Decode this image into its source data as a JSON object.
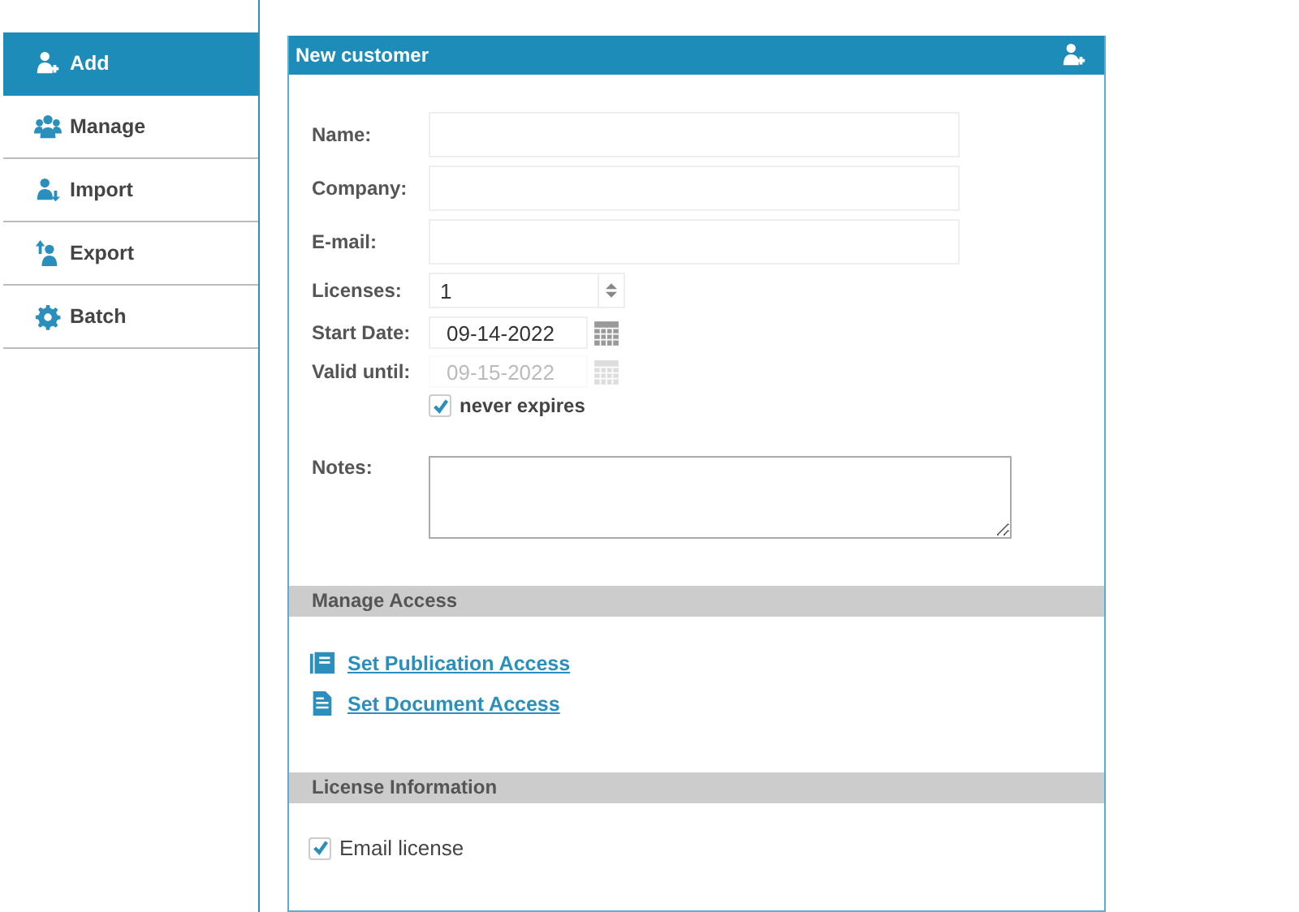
{
  "sidebar": {
    "items": [
      {
        "label": "Add",
        "selected": true
      },
      {
        "label": "Manage",
        "selected": false
      },
      {
        "label": "Import",
        "selected": false
      },
      {
        "label": "Export",
        "selected": false
      },
      {
        "label": "Batch",
        "selected": false
      }
    ]
  },
  "panel": {
    "title": "New customer",
    "fields": [
      {
        "kind": "text",
        "label": "Name:"
      },
      {
        "kind": "text",
        "label": "Company:"
      },
      {
        "kind": "text",
        "label": "E-mail:"
      },
      {
        "kind": "number",
        "label": "Licenses:",
        "value": "1"
      },
      {
        "kind": "date",
        "label": "Start Date:",
        "value": "09-14-2022",
        "disabled": false
      },
      {
        "kind": "date",
        "label": "Valid until:",
        "value": "09-15-2022",
        "disabled": true
      },
      {
        "kind": "checkbox",
        "label": "never expires",
        "checked": true
      },
      {
        "kind": "textarea",
        "label": "Notes:"
      }
    ],
    "sections": [
      {
        "title": "Manage Access",
        "items": [
          {
            "kind": "link",
            "label": "Set Publication Access"
          },
          {
            "kind": "link",
            "label": "Set Document Access"
          }
        ]
      },
      {
        "title": "License Information",
        "items": [
          {
            "kind": "checkbox",
            "label": "Email license",
            "checked": true
          }
        ]
      }
    ]
  }
}
